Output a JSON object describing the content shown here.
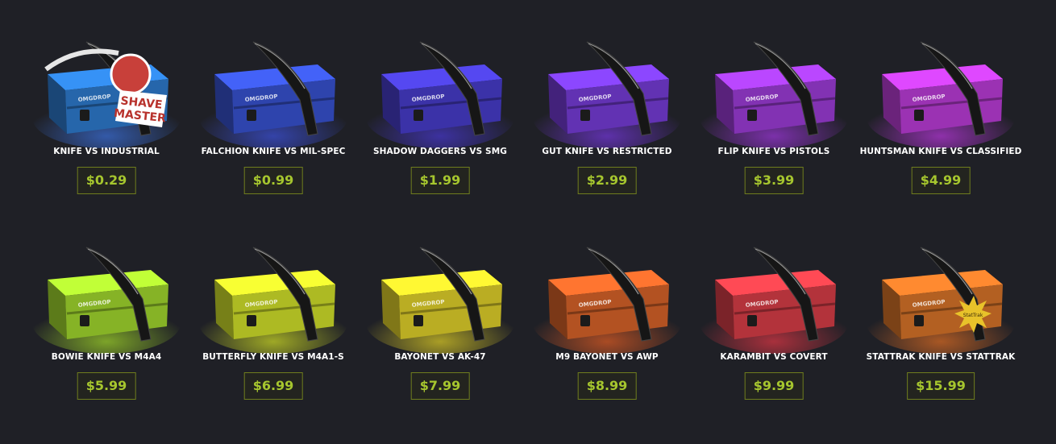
{
  "cases": [
    {
      "name": "KNIFE VS INDUSTRIAL",
      "price": "$0.29",
      "color": "#2f7fd6",
      "glow": "#3a6dd4",
      "icon": "karambit-shave-master-icon",
      "badge": "SHAVE MASTER"
    },
    {
      "name": "FALCHION KNIFE VS MIL-SPEC",
      "price": "$0.99",
      "color": "#3a55d8",
      "glow": "#3b4fd4",
      "icon": "falchion-knife-case-icon"
    },
    {
      "name": "SHADOW DAGGERS VS SMG",
      "price": "$1.99",
      "color": "#4a3fd2",
      "glow": "#4637c8",
      "icon": "shadow-daggers-case-icon"
    },
    {
      "name": "GUT KNIFE VS RESTRICTED",
      "price": "$2.99",
      "color": "#7a3ee0",
      "glow": "#7236d6",
      "icon": "gut-knife-case-icon"
    },
    {
      "name": "FLIP KNIFE VS PISTOLS",
      "price": "$3.99",
      "color": "#a23ee0",
      "glow": "#9a36d6",
      "icon": "flip-knife-case-icon"
    },
    {
      "name": "HUNTSMAN KNIFE VS CLASSIFIED",
      "price": "$4.99",
      "color": "#c23fe0",
      "glow": "#b336d6",
      "icon": "huntsman-knife-case-icon"
    },
    {
      "name": "BOWIE KNIFE VS M4A4",
      "price": "$5.99",
      "color": "#a8e030",
      "glow": "#9cd02a",
      "icon": "bowie-knife-case-icon"
    },
    {
      "name": "BUTTERFLY KNIFE VS M4A1-S",
      "price": "$6.99",
      "color": "#d8e82c",
      "glow": "#c9d626",
      "icon": "butterfly-knife-case-icon"
    },
    {
      "name": "BAYONET VS AK-47",
      "price": "$7.99",
      "color": "#e8d82c",
      "glow": "#d8c826",
      "icon": "bayonet-case-icon"
    },
    {
      "name": "M9 BAYONET VS AWP",
      "price": "$8.99",
      "color": "#e0662a",
      "glow": "#d85a24",
      "icon": "m9-bayonet-case-icon"
    },
    {
      "name": "KARAMBIT VS COVERT",
      "price": "$9.99",
      "color": "#e0404a",
      "glow": "#d63644",
      "icon": "karambit-case-icon"
    },
    {
      "name": "STATTRAK KNIFE VS STATTRAK",
      "price": "$15.99",
      "color": "#e0782a",
      "glow": "#d66a24",
      "icon": "stattrak-karambit-case-icon",
      "badge": "StatTrak"
    }
  ],
  "brand": "OMGDROP"
}
